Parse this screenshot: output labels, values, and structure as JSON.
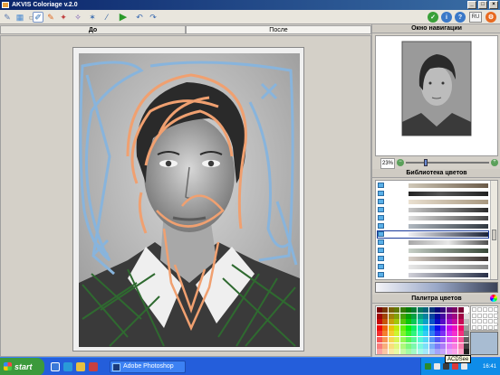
{
  "window": {
    "title": "AKVIS Coloriage v.2.0"
  },
  "toolbar": {
    "tools": [
      "pencil-icon",
      "fill-icon",
      "eraser-icon",
      "brush-icon",
      "color-brush-icon",
      "magic-brush-icon",
      "pipette-icon",
      "run-icon",
      "undo-icon",
      "redo-icon"
    ],
    "right_tools": [
      "apply-icon",
      "info-icon",
      "help-icon",
      "settings-icon",
      "close-icon"
    ],
    "language": "RU"
  },
  "tabs": {
    "before": "До",
    "after": "После"
  },
  "panels": {
    "navigator_title": "Окно навигации",
    "zoom": "23%",
    "library_title": "Библиотека цветов",
    "palette_title": "Палитра цветов"
  },
  "taskbar": {
    "start": "start",
    "task": "Adobe Photoshop",
    "tooltip": "ACDSee",
    "clock": "16:41"
  },
  "colors": {
    "stroke_orange": "#f0a070",
    "stroke_blue": "#88b4dc",
    "stroke_green": "#2f6a30",
    "current_color": "#a8bcd2"
  }
}
